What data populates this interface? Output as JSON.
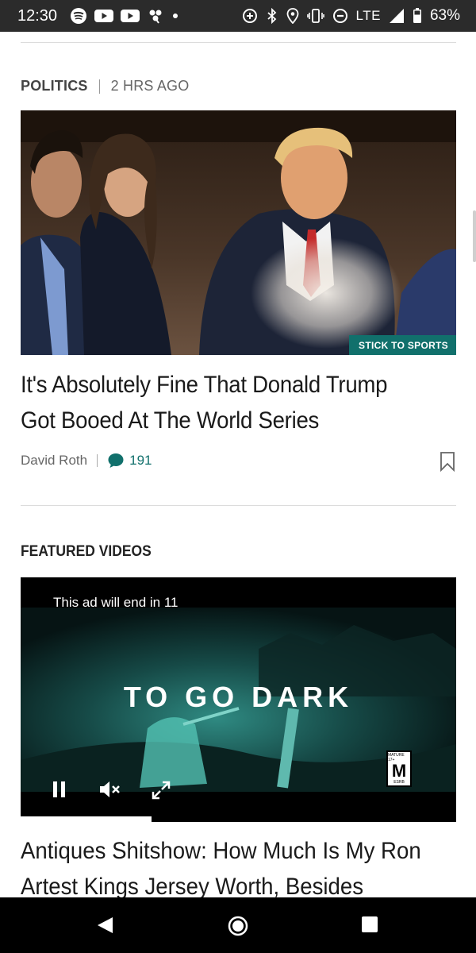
{
  "status_bar": {
    "time": "12:30",
    "network": "LTE",
    "battery": "63%",
    "left_icons": [
      "spotify-icon",
      "youtube-icon",
      "youtube-icon",
      "pinwheel-icon",
      "dot-icon"
    ],
    "right_icons": [
      "data-saver-icon",
      "bluetooth-icon",
      "location-icon",
      "vibrate-icon",
      "dnd-icon",
      "signal-icon",
      "battery-icon"
    ]
  },
  "article": {
    "category": "POLITICS",
    "time_ago": "2 HRS AGO",
    "image_tag": "STICK TO SPORTS",
    "headline": "It's Absolutely Fine That Donald Trump Got Booed At The World Series",
    "author": "David Roth",
    "comment_count": "191",
    "accent_color": "#11706c"
  },
  "featured": {
    "title": "FEATURED VIDEOS",
    "ad_text": "This ad will end in 11",
    "video_text": "TO GO DARK",
    "rating_top": "MATURE 17+",
    "rating_letter": "M",
    "rating_bottom": "ESRB",
    "progress": 0.3
  },
  "next_article": {
    "headline_line1": "Antiques Shitshow: How Much Is My Ron",
    "headline_line2": "Artest Kings Jersey Worth, Besides"
  },
  "nav_bar": {
    "icons": [
      "back-icon",
      "home-icon",
      "recents-icon"
    ]
  }
}
